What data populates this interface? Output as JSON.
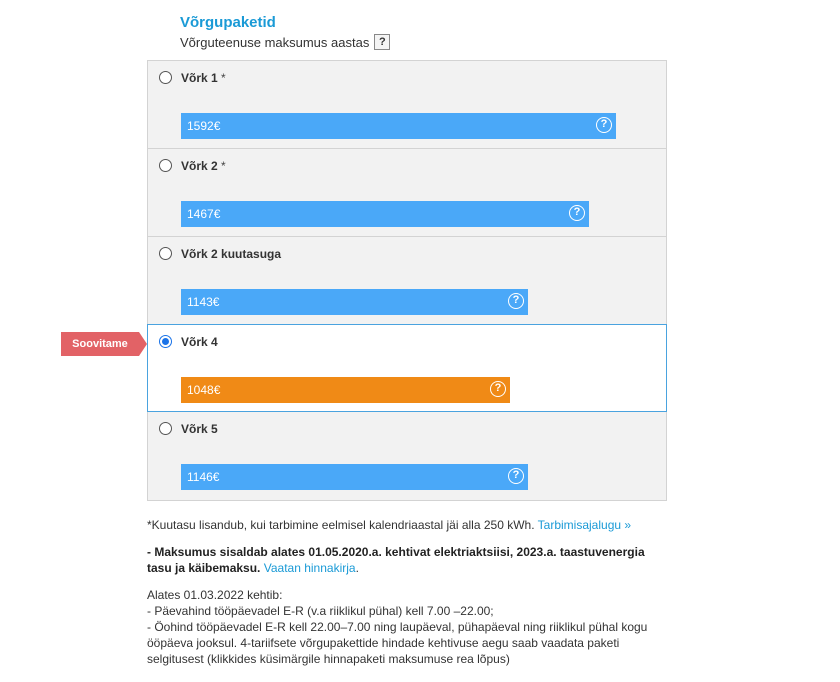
{
  "header": {
    "title": "Võrgupaketid",
    "subtitle": "Võrguteenuse maksumus aastas",
    "help_icon": "?"
  },
  "recommend_label": "Soovitame",
  "packages": [
    {
      "name": "Võrk 1",
      "star": "*",
      "price": "1592€",
      "fill": 0.915,
      "color": "#4aa8f8",
      "selected": false
    },
    {
      "name": "Võrk 2",
      "star": "*",
      "price": "1467€",
      "fill": 0.858,
      "color": "#4aa8f8",
      "selected": false
    },
    {
      "name": "Võrk 2 kuutasuga",
      "star": "",
      "price": "1143€",
      "fill": 0.731,
      "color": "#4aa8f8",
      "selected": false
    },
    {
      "name": "Võrk 4",
      "star": "",
      "price": "1048€",
      "fill": 0.693,
      "color": "#f08a16",
      "selected": true
    },
    {
      "name": "Võrk 5",
      "star": "",
      "price": "1146€",
      "fill": 0.731,
      "color": "#4aa8f8",
      "selected": false
    }
  ],
  "notes": {
    "footnote_text": "*Kuutasu lisandub, kui tarbimine eelmisel kalendriaastal jäi alla 250 kWh.",
    "footnote_link": "Tarbimisajalugu »",
    "price_info_bold": "- Maksumus sisaldab alates 01.05.2020.a. kehtivat elektriaktsiisi, 2023.a. taastuvenergia tasu ja käibemaksu.",
    "price_info_link": "Vaatan hinnakirja",
    "price_info_end": ".",
    "tariff_line1": "Alates 01.03.2022 kehtib:",
    "tariff_line2": "- Päevahind tööpäevadel E-R (v.a riiklikul pühal) kell 7.00 –22.00;",
    "tariff_line3": "- Öohind tööpäevadel E-R kell 22.00–7.00 ning laupäeval, pühapäeval ning riiklikul pühal kogu ööpäeva jooksul. 4-tariifsete võrgupakettide hindade kehtivuse aegu saab vaadata paketi selgitusest (klikkides küsimärgile hinnapaketi maksumuse rea lõpus)"
  }
}
